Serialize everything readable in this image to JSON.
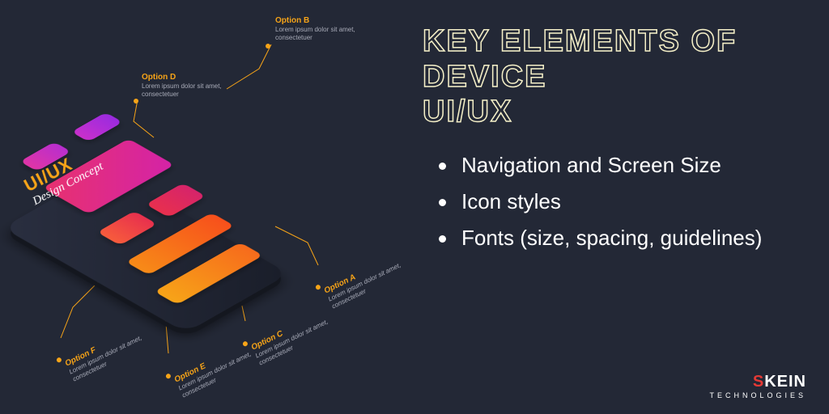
{
  "title_line1": "KEY ELEMENTS OF DEVICE",
  "title_line2": "UI/UX",
  "bullets": [
    "Navigation and Screen Size",
    "Icon styles",
    "Fonts (size, spacing, guidelines)"
  ],
  "side_label": {
    "t1": "UI/UX",
    "t2": "Design Concept"
  },
  "callouts": {
    "a": {
      "title": "Option A",
      "body": "Lorem ipsum dolor sit amet, consectetuer"
    },
    "b": {
      "title": "Option B",
      "body": "Lorem ipsum dolor sit amet, consectetuer"
    },
    "c": {
      "title": "Option C",
      "body": "Lorem ipsum dolor sit amet, consectetuer"
    },
    "d": {
      "title": "Option D",
      "body": "Lorem ipsum dolor sit amet, consectetuer"
    },
    "e": {
      "title": "Option E",
      "body": "Lorem ipsum dolor sit amet, consectetuer"
    },
    "f": {
      "title": "Option F",
      "body": "Lorem ipsum dolor sit amet, consectetuer"
    }
  },
  "brand": {
    "name1": "S",
    "name2": "KEIN",
    "sub": "TECHNOLOGIES"
  },
  "colors": {
    "accent": "#f7a418",
    "bg": "#232836",
    "outline": "#f5f0c8",
    "red": "#e53935"
  }
}
